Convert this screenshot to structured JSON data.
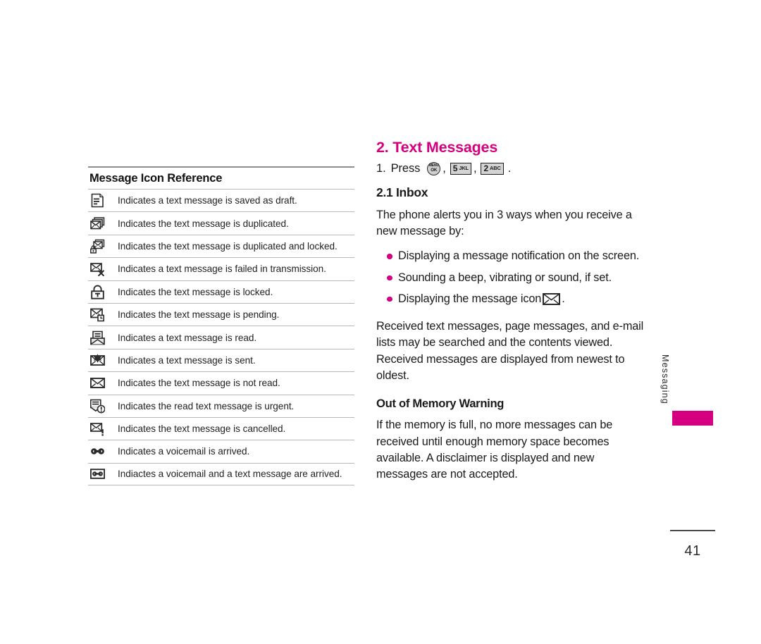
{
  "page": {
    "number": "41",
    "side_tab_label": "Messaging",
    "accent_color": "#d4007f"
  },
  "left_column": {
    "title": "Message Icon Reference",
    "rows": [
      {
        "icon": "draft-message-icon",
        "text": "Indicates a text message is saved as draft."
      },
      {
        "icon": "duplicated-message-icon",
        "text": "Indicates the text message is duplicated."
      },
      {
        "icon": "duplicated-locked-message-icon",
        "text": "Indicates the text message is duplicated and locked."
      },
      {
        "icon": "failed-transmission-message-icon",
        "text": "Indicates a text message is failed in transmission."
      },
      {
        "icon": "locked-message-icon",
        "text": "Indicates the text message is locked."
      },
      {
        "icon": "pending-message-icon",
        "text": "Indicates the text message is pending."
      },
      {
        "icon": "read-message-icon",
        "text": "Indicates a text message is read."
      },
      {
        "icon": "sent-message-icon",
        "text": "Indicates a text message is sent."
      },
      {
        "icon": "unread-message-icon",
        "text": "Indicates the text message is not read."
      },
      {
        "icon": "urgent-read-message-icon",
        "text": "Indicates the read text message is urgent."
      },
      {
        "icon": "cancelled-message-icon",
        "text": "Indicates the text message is cancelled."
      },
      {
        "icon": "voicemail-icon",
        "text": "Indicates a voicemail is arrived."
      },
      {
        "icon": "voicemail-and-text-icon",
        "text": "Indiactes a voicemail and a text message are arrived."
      }
    ]
  },
  "right_column": {
    "chapter_heading": "2. Text Messages",
    "press_step": {
      "number": "1.",
      "verb": "Press",
      "keys": [
        {
          "type": "round",
          "top": "MENU",
          "bottom": "OK",
          "name": "menu-ok-key-icon"
        },
        {
          "type": "rect",
          "digit": "5",
          "letters": "JKL",
          "name": "key-5-jkl-icon"
        },
        {
          "type": "rect",
          "digit": "2",
          "letters": "ABC",
          "name": "key-2-abc-icon"
        }
      ],
      "separator": ",",
      "terminator": "."
    },
    "inbox_heading": "2.1 Inbox",
    "intro_paragraph": "The phone alerts you in 3 ways when you receive a new message by:",
    "bullets": [
      {
        "text_before": "Displaying a message notification on the screen.",
        "has_icon": false,
        "text_after": ""
      },
      {
        "text_before": "Sounding a beep, vibrating or sound, if set.",
        "has_icon": false,
        "text_after": ""
      },
      {
        "text_before": "Displaying the message icon",
        "has_icon": true,
        "text_after": "."
      }
    ],
    "received_paragraph": "Received text messages, page messages, and e-mail lists may be searched and the contents viewed. Received messages are displayed from newest to oldest.",
    "memory_heading": "Out of Memory Warning",
    "memory_paragraph": "If the memory is full, no more messages can be received until enough memory space becomes available. A disclaimer is displayed and new messages are not accepted."
  }
}
